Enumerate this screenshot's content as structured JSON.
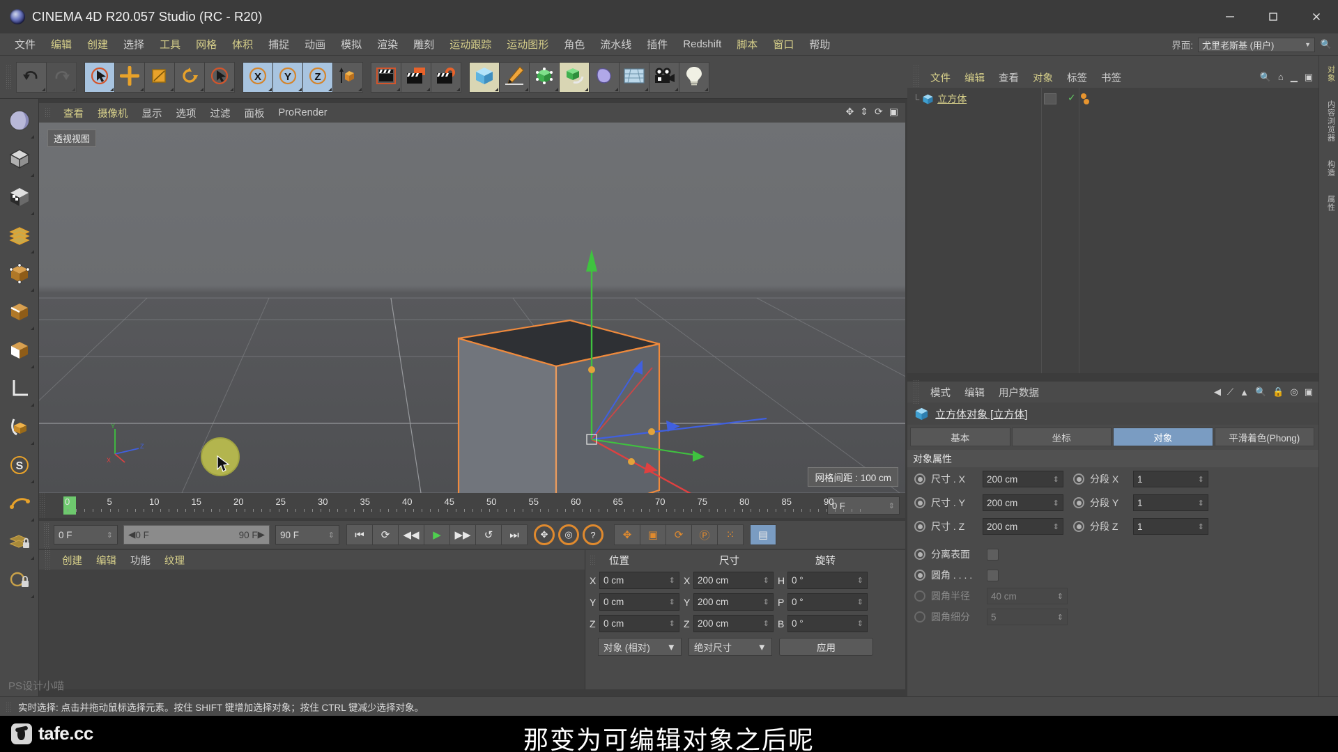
{
  "window": {
    "title": "CINEMA 4D R20.057 Studio (RC - R20)",
    "logo_icon": "c4d-logo-icon",
    "minimize_label": "—",
    "maximize_label": "□",
    "close_label": "✕"
  },
  "menubar": {
    "items": [
      {
        "label": "文件",
        "hl": false
      },
      {
        "label": "编辑",
        "hl": true
      },
      {
        "label": "创建",
        "hl": true
      },
      {
        "label": "选择",
        "hl": false
      },
      {
        "label": "工具",
        "hl": true
      },
      {
        "label": "网格",
        "hl": true
      },
      {
        "label": "体积",
        "hl": true
      },
      {
        "label": "捕捉",
        "hl": false
      },
      {
        "label": "动画",
        "hl": false
      },
      {
        "label": "模拟",
        "hl": false
      },
      {
        "label": "渲染",
        "hl": false
      },
      {
        "label": "雕刻",
        "hl": false
      },
      {
        "label": "运动跟踪",
        "hl": true
      },
      {
        "label": "运动图形",
        "hl": true
      },
      {
        "label": "角色",
        "hl": false
      },
      {
        "label": "流水线",
        "hl": false
      },
      {
        "label": "插件",
        "hl": false
      },
      {
        "label": "Redshift",
        "hl": false
      },
      {
        "label": "脚本",
        "hl": true
      },
      {
        "label": "窗口",
        "hl": true
      },
      {
        "label": "帮助",
        "hl": false
      }
    ],
    "interface_label": "界面:",
    "interface_value": "尤里老斯基 (用户)",
    "search_icon": "search-icon"
  },
  "toolbar": {
    "groups": [
      {
        "name": "undo-redo",
        "buttons": [
          {
            "name": "undo-button",
            "icon": "undo-arrow-icon",
            "state": "normal"
          },
          {
            "name": "redo-button",
            "icon": "redo-arrow-icon",
            "state": "disabled"
          }
        ]
      },
      {
        "name": "selection-tools",
        "buttons": [
          {
            "name": "live-selection-button",
            "icon": "live-selection-icon",
            "state": "active"
          },
          {
            "name": "move-button",
            "icon": "move-cross-icon",
            "state": "normal"
          },
          {
            "name": "scale-button",
            "icon": "scale-box-icon",
            "state": "normal"
          },
          {
            "name": "rotate-button",
            "icon": "rotate-circle-icon",
            "state": "normal"
          },
          {
            "name": "select-arrow-button",
            "icon": "arrow-cursor-icon",
            "state": "normal"
          }
        ]
      },
      {
        "name": "axis-locks",
        "buttons": [
          {
            "name": "lock-x-button",
            "icon": "axis-x-icon",
            "state": "active",
            "label": "X"
          },
          {
            "name": "lock-y-button",
            "icon": "axis-y-icon",
            "state": "active",
            "label": "Y"
          },
          {
            "name": "lock-z-button",
            "icon": "axis-z-icon",
            "state": "active",
            "label": "Z"
          },
          {
            "name": "world-local-button",
            "icon": "world-coordinate-icon",
            "state": "normal"
          }
        ]
      },
      {
        "name": "render-tools",
        "buttons": [
          {
            "name": "render-view-button",
            "icon": "clapperboard-icon",
            "state": "normal"
          },
          {
            "name": "render-region-button",
            "icon": "clapperboard-region-icon",
            "state": "normal"
          },
          {
            "name": "render-settings-button",
            "icon": "clapperboard-gear-icon",
            "state": "normal"
          }
        ]
      },
      {
        "name": "object-creation",
        "buttons": [
          {
            "name": "add-primitive-button",
            "icon": "cube-blue-icon",
            "state": "active2"
          },
          {
            "name": "add-spline-button",
            "icon": "pen-icon",
            "state": "normal"
          },
          {
            "name": "add-generator-button",
            "icon": "green-cube-icon",
            "state": "normal"
          },
          {
            "name": "add-deformer-button",
            "icon": "green-cube-bend-icon",
            "state": "active2"
          },
          {
            "name": "add-environment-button",
            "icon": "sky-blob-icon",
            "state": "normal"
          },
          {
            "name": "add-scene-button",
            "icon": "floor-grid-icon",
            "state": "normal"
          },
          {
            "name": "add-camera-button",
            "icon": "camera-icon",
            "state": "normal"
          },
          {
            "name": "add-light-button",
            "icon": "lightbulb-icon",
            "state": "normal"
          }
        ]
      }
    ]
  },
  "left_palette": {
    "items": [
      {
        "name": "tool-texture-axis",
        "icon": "sphere-checker-icon"
      },
      {
        "name": "tool-model-mode",
        "icon": "cube-outline-icon"
      },
      {
        "name": "tool-texture-mode",
        "icon": "checker-square-icon"
      },
      {
        "name": "tool-polygon-mode",
        "icon": "polygon-mesh-icon"
      },
      {
        "name": "tool-point-mode",
        "icon": "cube-points-icon"
      },
      {
        "name": "tool-edge-mode",
        "icon": "cube-edge-icon"
      },
      {
        "name": "tool-face-mode",
        "icon": "cube-face-icon"
      },
      {
        "name": "tool-axis-mode",
        "icon": "axis-L-icon"
      },
      {
        "name": "tool-enable-axis",
        "icon": "axis-modify-icon"
      },
      {
        "name": "tool-snap",
        "icon": "snap-S-icon"
      },
      {
        "name": "tool-workplane",
        "icon": "workplane-icon"
      },
      {
        "name": "tool-uv-lock",
        "icon": "uv-lock-icon"
      },
      {
        "name": "tool-viewport-lock",
        "icon": "viewport-lock-icon"
      }
    ]
  },
  "viewport": {
    "menu": [
      {
        "label": "查看",
        "hl": true
      },
      {
        "label": "摄像机",
        "hl": true
      },
      {
        "label": "显示",
        "hl": false
      },
      {
        "label": "选项",
        "hl": false
      },
      {
        "label": "过滤",
        "hl": false
      },
      {
        "label": "面板",
        "hl": false
      },
      {
        "label": "ProRender",
        "hl": false
      }
    ],
    "perspective_label": "透视视图",
    "grid_info": "网格间距 : 100 cm",
    "axis_x_label": "X",
    "axis_y_label": "Y",
    "axis_z_label": "Z",
    "view_icons": [
      "pan-view-icon",
      "dolly-view-icon",
      "rotate-view-icon",
      "maximize-view-icon"
    ]
  },
  "timeline": {
    "ticks": [
      "0",
      "5",
      "10",
      "15",
      "20",
      "25",
      "30",
      "35",
      "40",
      "45",
      "50",
      "55",
      "60",
      "65",
      "70",
      "75",
      "80",
      "85",
      "90"
    ],
    "current_frame_box": "0 F",
    "playhead_frame": "0"
  },
  "transport": {
    "current_frame": "0 F",
    "range_start": "0 F",
    "range_end": "90 F",
    "end_frame": "90 F",
    "buttons": [
      {
        "name": "goto-start-button",
        "icon": "skip-start-icon"
      },
      {
        "name": "loop-button",
        "icon": "loop-icon"
      },
      {
        "name": "step-back-button",
        "icon": "step-back-icon"
      },
      {
        "name": "play-button",
        "icon": "play-icon"
      },
      {
        "name": "step-forward-button",
        "icon": "step-forward-icon"
      },
      {
        "name": "play-reverse-button",
        "icon": "play-reverse-icon"
      },
      {
        "name": "goto-end-button",
        "icon": "skip-end-icon"
      }
    ],
    "right_buttons": [
      {
        "name": "record-keyframe-button",
        "icon": "record-circle-icon"
      },
      {
        "name": "autokey-button",
        "icon": "autokey-circle-icon"
      },
      {
        "name": "keyframe-help-button",
        "icon": "question-circle-icon"
      },
      {
        "name": "record-position-button",
        "icon": "position-key-icon"
      },
      {
        "name": "record-scale-button",
        "icon": "scale-key-icon"
      },
      {
        "name": "record-rotation-button",
        "icon": "rotation-key-icon"
      },
      {
        "name": "record-param-button",
        "icon": "param-key-icon"
      },
      {
        "name": "record-pla-button",
        "icon": "pla-key-icon"
      },
      {
        "name": "timeline-layout-button",
        "icon": "timeline-layout-icon"
      }
    ]
  },
  "material_manager": {
    "menu": [
      {
        "label": "创建",
        "hl": true
      },
      {
        "label": "编辑",
        "hl": true
      },
      {
        "label": "功能",
        "hl": false
      },
      {
        "label": "纹理",
        "hl": true
      }
    ]
  },
  "coordinate_manager": {
    "headers": [
      "位置",
      "尺寸",
      "旋转"
    ],
    "rows": [
      {
        "axis1": "X",
        "pos": "0 cm",
        "axis2": "X",
        "size": "200 cm",
        "axis3": "H",
        "rot": "0 °"
      },
      {
        "axis1": "Y",
        "pos": "0 cm",
        "axis2": "Y",
        "size": "200 cm",
        "axis3": "P",
        "rot": "0 °"
      },
      {
        "axis1": "Z",
        "pos": "0 cm",
        "axis2": "Z",
        "size": "200 cm",
        "axis3": "B",
        "rot": "0 °"
      }
    ],
    "mode_dropdown": "对象 (相对)",
    "size_dropdown": "绝对尺寸",
    "apply_button": "应用"
  },
  "object_manager": {
    "menu": [
      {
        "label": "文件",
        "hl": true
      },
      {
        "label": "编辑",
        "hl": true
      },
      {
        "label": "查看",
        "hl": false
      },
      {
        "label": "对象",
        "hl": true
      },
      {
        "label": "标签",
        "hl": false
      },
      {
        "label": "书签",
        "hl": false
      }
    ],
    "icons": [
      "search-icon",
      "home-icon",
      "minimize-panel-icon",
      "maximize-panel-icon"
    ],
    "objects": [
      {
        "name": "立方体",
        "icon": "cube-blue-icon",
        "visible_dot_top": "orange",
        "visible_dot_bottom": "orange",
        "enabled": "✓"
      }
    ]
  },
  "attribute_manager": {
    "menu": [
      {
        "label": "模式",
        "hl": false
      },
      {
        "label": "编辑",
        "hl": false
      },
      {
        "label": "用户数据",
        "hl": false
      }
    ],
    "icons": [
      "back-arrow-icon",
      "forward-arrow-icon",
      "up-arrow-icon",
      "search-icon",
      "lock-icon",
      "target-icon",
      "maximize-panel-icon"
    ],
    "object_title": "立方体对象 [立方体]",
    "object_icon": "cube-blue-icon",
    "tabs": [
      {
        "label": "基本",
        "selected": false
      },
      {
        "label": "坐标",
        "selected": false
      },
      {
        "label": "对象",
        "selected": true
      },
      {
        "label": "平滑着色(Phong)",
        "selected": false
      }
    ],
    "section_title": "对象属性",
    "properties": [
      {
        "label": "尺寸 . X",
        "value": "200 cm",
        "label2": "分段 X",
        "value2": "1",
        "disabled": false
      },
      {
        "label": "尺寸 . Y",
        "value": "200 cm",
        "label2": "分段 Y",
        "value2": "1",
        "disabled": false
      },
      {
        "label": "尺寸 . Z",
        "value": "200 cm",
        "label2": "分段 Z",
        "value2": "1",
        "disabled": false
      }
    ],
    "checkboxes": [
      {
        "label": "分离表面",
        "checked": false,
        "disabled": false
      },
      {
        "label": "圆角 . . . .",
        "checked": false,
        "disabled": false
      }
    ],
    "fillet_fields": [
      {
        "label": "圆角半径",
        "value": "40 cm",
        "disabled": true
      },
      {
        "label": "圆角细分",
        "value": "5",
        "disabled": true
      }
    ]
  },
  "right_strip": {
    "tabs": [
      "对象",
      "内容浏览器",
      "构造",
      "属性"
    ]
  },
  "statusbar": {
    "text": "实时选择: 点击并拖动鼠标选择元素。按住 SHIFT 键增加选择对象；按住 CTRL 键减少选择对象。"
  },
  "subtitle": {
    "text": "那变为可编辑对象之后呢",
    "brand": "tafe.cc",
    "brand_icon": "tafe-logo-icon",
    "watermark": "PS设计小喵"
  },
  "colors": {
    "panel_bg": "#4a4a4a",
    "panel_dark": "#414141",
    "accent_yellow": "#d6cf8a",
    "accent_blue": "#7a9cc2",
    "selection_orange": "#f08a3c",
    "axis_x": "#e04040",
    "axis_y": "#40c040",
    "axis_z": "#4060e0"
  }
}
